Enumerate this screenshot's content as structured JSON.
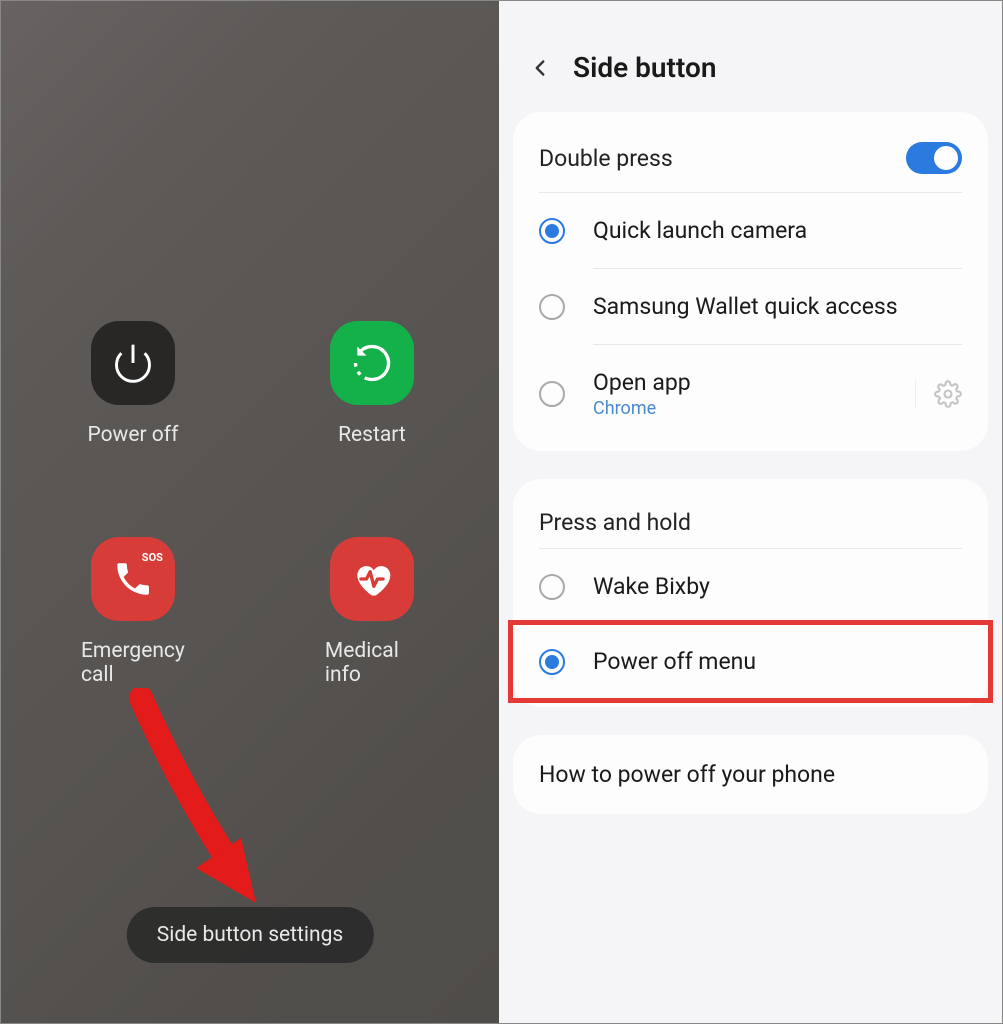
{
  "left": {
    "items": [
      {
        "label": "Power off",
        "icon": "power-icon"
      },
      {
        "label": "Restart",
        "icon": "restart-icon"
      },
      {
        "label": "Emergency call",
        "icon": "emergency-icon",
        "badge": "SOS"
      },
      {
        "label": "Medical info",
        "icon": "medical-icon"
      }
    ],
    "bottom_button": "Side button settings"
  },
  "right": {
    "title": "Side button",
    "double_press": {
      "header": "Double press",
      "toggle_on": true,
      "options": [
        {
          "label": "Quick launch camera",
          "selected": true
        },
        {
          "label": "Samsung Wallet quick access",
          "selected": false
        },
        {
          "label": "Open app",
          "sublabel": "Chrome",
          "selected": false,
          "has_gear": true
        }
      ]
    },
    "press_hold": {
      "header": "Press and hold",
      "options": [
        {
          "label": "Wake Bixby",
          "selected": false
        },
        {
          "label": "Power off menu",
          "selected": true,
          "highlighted": true
        }
      ]
    },
    "footer_link": "How to power off your phone"
  }
}
